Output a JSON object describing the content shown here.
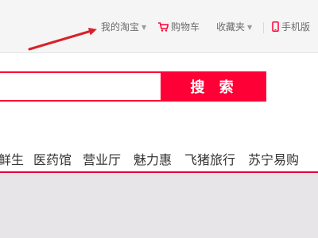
{
  "topbar": {
    "my_taobao": "我的淘宝",
    "cart": "购物车",
    "favorites": "收藏夹",
    "mobile": "手机版"
  },
  "search": {
    "value": "",
    "placeholder": "",
    "button_label": "搜 索"
  },
  "nav": {
    "items": [
      "鲜生",
      "医药馆",
      "营业厅",
      "魅力惠",
      "飞猪旅行",
      "苏宁易购"
    ]
  },
  "colors": {
    "brand_red": "#ff0036",
    "topbar_bg": "#f5f5f5",
    "arrow": "#d9222a"
  },
  "icons": {
    "cart": "shopping-cart-icon",
    "mobile": "mobile-phone-icon",
    "dropdown": "chevron-down-icon"
  }
}
